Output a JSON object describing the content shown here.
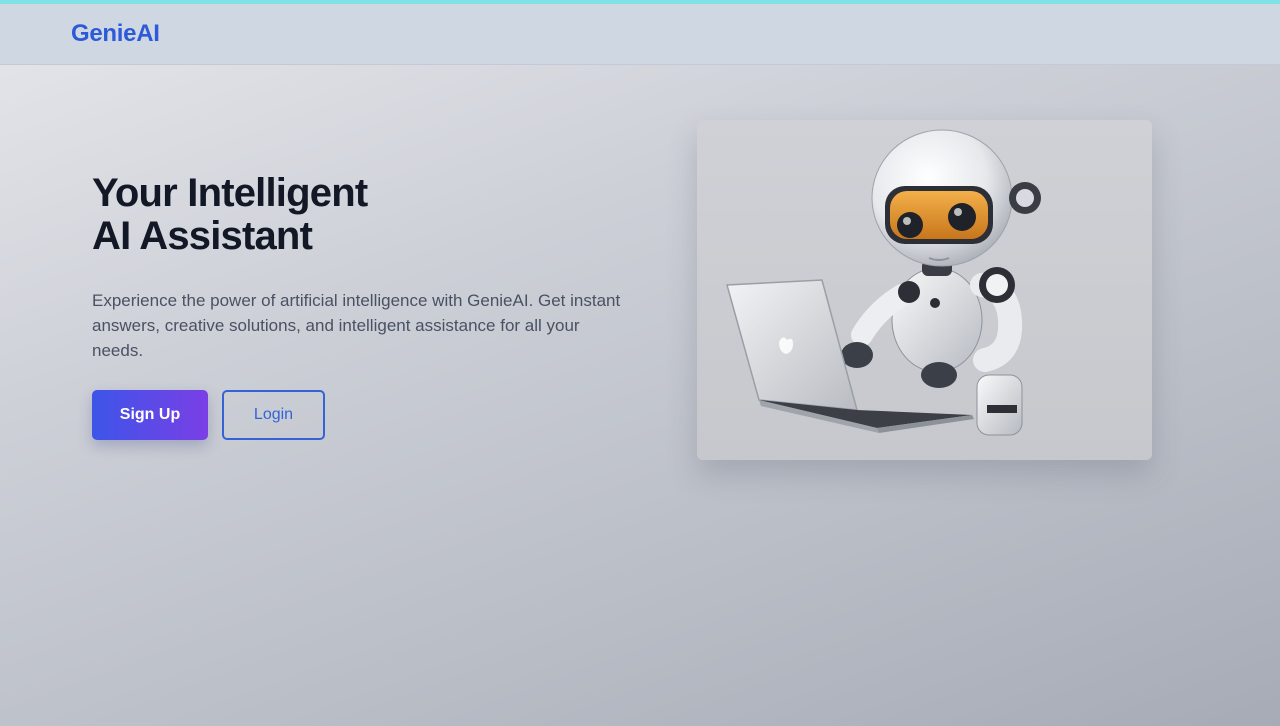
{
  "nav": {
    "brand": "GenieAI"
  },
  "hero": {
    "title_line1": "Your Intelligent",
    "title_line2": "AI Assistant",
    "description": "Experience the power of artificial intelligence with GenieAI. Get instant answers, creative solutions, and intelligent assistance for all your needs.",
    "signup_label": "Sign Up",
    "login_label": "Login"
  },
  "illustration": {
    "subject": "robot-using-laptop"
  },
  "colors": {
    "brand": "#2d5bd8",
    "accent_gradient_start": "#3d55e8",
    "accent_gradient_end": "#7a3fe6",
    "navbar_bg": "#cfd7e3"
  }
}
